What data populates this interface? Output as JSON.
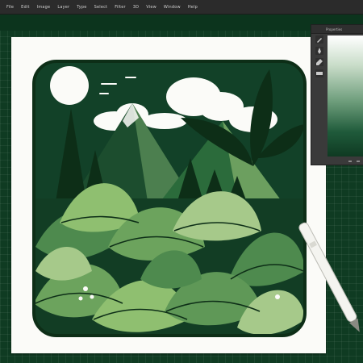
{
  "menubar": {
    "items": [
      "File",
      "Edit",
      "Image",
      "Layer",
      "Type",
      "Select",
      "Filter",
      "3D",
      "View",
      "Window",
      "Help"
    ]
  },
  "panel": {
    "title": "Properties",
    "tools": [
      "brush-tool-icon",
      "pen-tool-icon",
      "eyedropper-tool-icon",
      "gradient-tool-icon"
    ]
  },
  "colors": {
    "accent_dark_green": "#0f3a22",
    "leaf_mid_green": "#4e8a4e",
    "leaf_light_green": "#8fbf70",
    "ink_dark": "#0d2e17"
  }
}
